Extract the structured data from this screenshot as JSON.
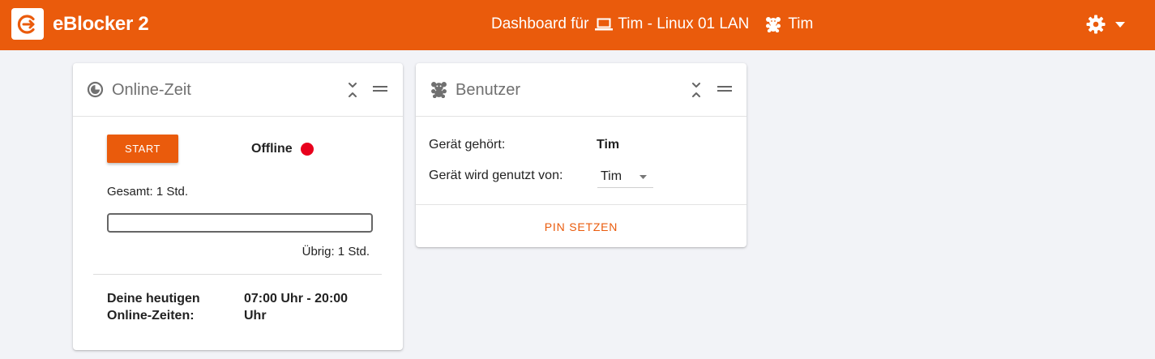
{
  "header": {
    "brand": "eBlocker 2",
    "dashboard_label": "Dashboard für",
    "device_name": "Tim - Linux 01 LAN",
    "user_name": "Tim",
    "colors": {
      "bar": "#ea5b0c",
      "text": "#ffffff"
    },
    "icons": [
      "eblocker-logo-icon",
      "laptop-icon",
      "teddy-bear-icon",
      "gear-icon",
      "caret-down-icon"
    ]
  },
  "online_time": {
    "title": "Online-Zeit",
    "icon": "pie-clock-icon",
    "start_label": "START",
    "status": "Offline",
    "status_color": "#e8001c",
    "total": "Gesamt: 1 Std.",
    "progress_fraction": 0,
    "remaining": "Übrig: 1 Std.",
    "today_label": "Deine heutigen Online-Zeiten:",
    "today_value": "07:00 Uhr - 20:00 Uhr"
  },
  "user_card": {
    "title": "Benutzer",
    "icon": "teddy-bear-icon",
    "owner_label": "Gerät gehört:",
    "owner_value": "Tim",
    "used_by_label": "Gerät wird genutzt von:",
    "used_by_value": "Tim",
    "pin_label": "PIN SETZEN"
  }
}
